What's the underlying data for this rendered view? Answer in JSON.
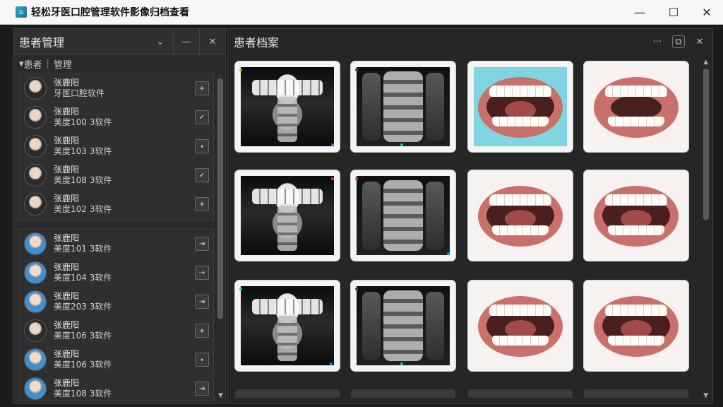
{
  "window": {
    "title": "轻松牙医口腔管理软件影像归档查看",
    "controls": {
      "minimize": "—",
      "maximize": "☐",
      "close": "✕"
    }
  },
  "left_panel": {
    "title": "患者管理",
    "ctrl_dropdown": "⌄",
    "ctrl_minimize": "—",
    "ctrl_close": "✕",
    "breadcrumb": {
      "part1": "患者",
      "part2": "管理"
    },
    "group1": [
      {
        "name": "张鹿阳",
        "info": "牙医口腔软件",
        "action": "+"
      },
      {
        "name": "张鹿阳",
        "info": "美度100 3软件",
        "action": "✓"
      },
      {
        "name": "张鹿阳",
        "info": "美度103 3软件",
        "action": "⬩"
      },
      {
        "name": "张鹿阳",
        "info": "美度108 3软件",
        "action": "✓"
      },
      {
        "name": "张鹿阳",
        "info": "美度102 3软件",
        "action": "+"
      }
    ],
    "group2": [
      {
        "name": "张鹿阳",
        "info": "美度101 3软件",
        "action": "⇥"
      },
      {
        "name": "张鹿阳",
        "info": "美度104 3软件",
        "action": "⇢"
      },
      {
        "name": "张鹿阳",
        "info": "美度203 3软件",
        "action": "⇥"
      },
      {
        "name": "张鹿阳",
        "info": "美度106 3软件",
        "action": "+"
      },
      {
        "name": "张鹿阳",
        "info": "美度106 3软件",
        "action": "⬩"
      },
      {
        "name": "张鹿阳",
        "info": "美度108 3软件",
        "action": "⇥"
      }
    ]
  },
  "right_panel": {
    "title": "患者档案",
    "more": "···",
    "expand": "⧉",
    "close": "✕"
  }
}
